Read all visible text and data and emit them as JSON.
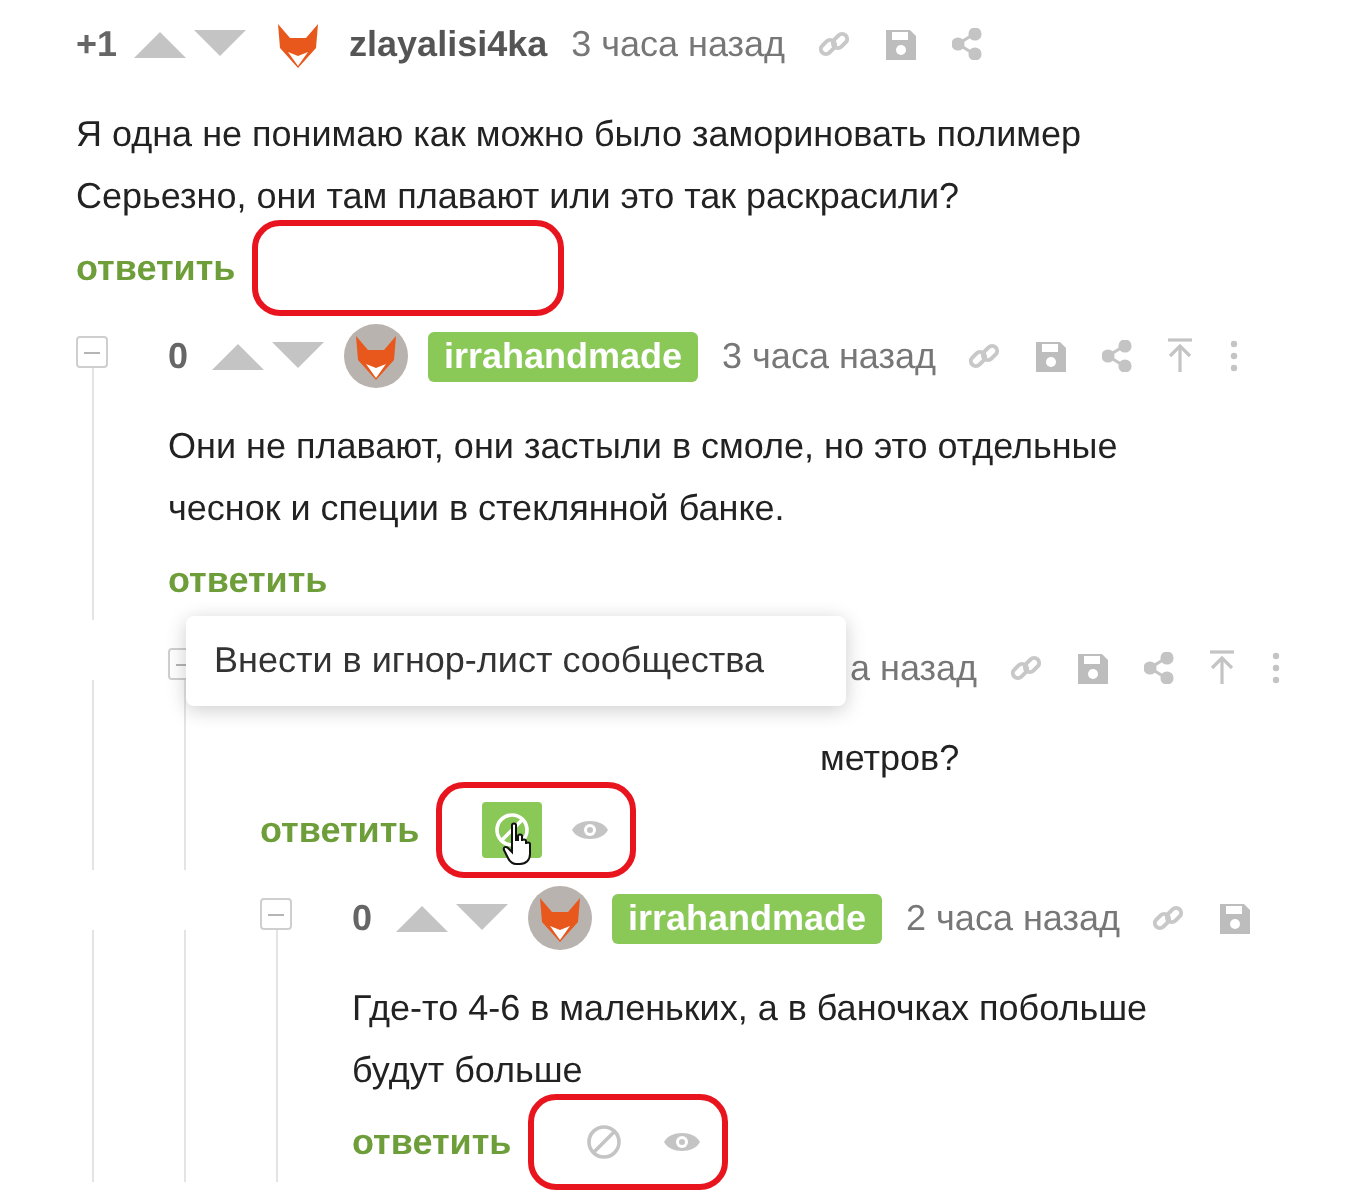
{
  "comments": [
    {
      "score": "+1",
      "author": "zlayalisi4ka",
      "author_badge": false,
      "time": "3 часа назад",
      "actions": [
        {
          "kind": "link"
        },
        {
          "kind": "save"
        },
        {
          "kind": "share"
        }
      ],
      "lines": [
        "Я одна не понимаю как можно было замориновать полимер",
        "Серьезно, они там плавают или это так раскрасили?"
      ],
      "reply": "ответить",
      "annotated": true,
      "collapsible": false,
      "children": [
        {
          "score": "0",
          "author": "irrahandmade",
          "author_badge": true,
          "time": "3 часа назад",
          "actions": [
            {
              "kind": "link"
            },
            {
              "kind": "save"
            },
            {
              "kind": "share"
            },
            {
              "kind": "top"
            },
            {
              "kind": "more"
            }
          ],
          "lines": [
            "Они не плавают, они застыли в смоле, но это отдельные",
            "чеснок и специи в стеклянной банке."
          ],
          "reply": "ответить",
          "annotated": false,
          "collapsible": true,
          "children": [
            {
              "time": "а назад",
              "actions": [
                {
                  "kind": "link"
                },
                {
                  "kind": "save"
                },
                {
                  "kind": "share"
                },
                {
                  "kind": "top"
                },
                {
                  "kind": "more"
                }
              ],
              "lines": [
                "метров?"
              ],
              "tooltip": "Внести в игнор-лист сообщества",
              "reply": "ответить",
              "tools": [
                {
                  "kind": "ignore",
                  "highlighted": true
                },
                {
                  "kind": "eye",
                  "highlighted": false
                }
              ],
              "annotated": true,
              "collapsible": true,
              "children": [
                {
                  "score": "0",
                  "author": "irrahandmade",
                  "author_badge": true,
                  "time": "2 часа назад",
                  "actions": [
                    {
                      "kind": "link"
                    },
                    {
                      "kind": "save"
                    }
                  ],
                  "lines": [
                    "Где-то 4-6 в маленьких, а в баночках побольше",
                    "будут больше"
                  ],
                  "reply": "ответить",
                  "tools": [
                    {
                      "kind": "ignore",
                      "highlighted": false
                    },
                    {
                      "kind": "eye",
                      "highlighted": false
                    }
                  ],
                  "annotated": true,
                  "collapsible": true
                }
              ]
            }
          ]
        }
      ]
    }
  ]
}
